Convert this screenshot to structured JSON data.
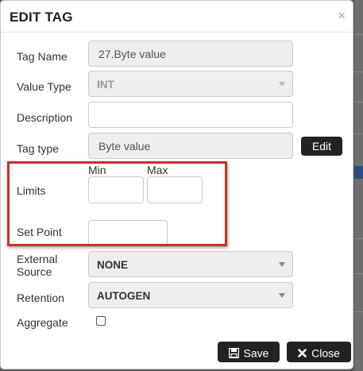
{
  "dialog": {
    "title": "EDIT TAG",
    "close_symbol": "×"
  },
  "form": {
    "tag_name": {
      "label": "Tag Name",
      "value": "27.Byte value"
    },
    "value_type": {
      "label": "Value Type",
      "selected": "INT"
    },
    "description": {
      "label": "Description",
      "value": ""
    },
    "tag_type": {
      "label": "Tag type",
      "value": "Byte value",
      "edit_label": "Edit"
    },
    "limits": {
      "label": "Limits",
      "min_label": "Min",
      "max_label": "Max",
      "min_value": "",
      "max_value": ""
    },
    "set_point": {
      "label": "Set Point",
      "value": ""
    },
    "external_source": {
      "label_line1": "External",
      "label_line2": "Source",
      "selected": "NONE"
    },
    "retention": {
      "label": "Retention",
      "selected": "AUTOGEN"
    },
    "aggregate": {
      "label": "Aggregate",
      "checked": false
    }
  },
  "footer": {
    "save_label": "Save",
    "close_label": "Close"
  },
  "icons": {
    "save": "floppy-disk-icon",
    "close": "x-icon",
    "dropdown": "caret-down-icon"
  },
  "colors": {
    "highlight_box": "#d42b2b",
    "button_dark": "#222222",
    "readonly_bg": "#eeeeee"
  }
}
